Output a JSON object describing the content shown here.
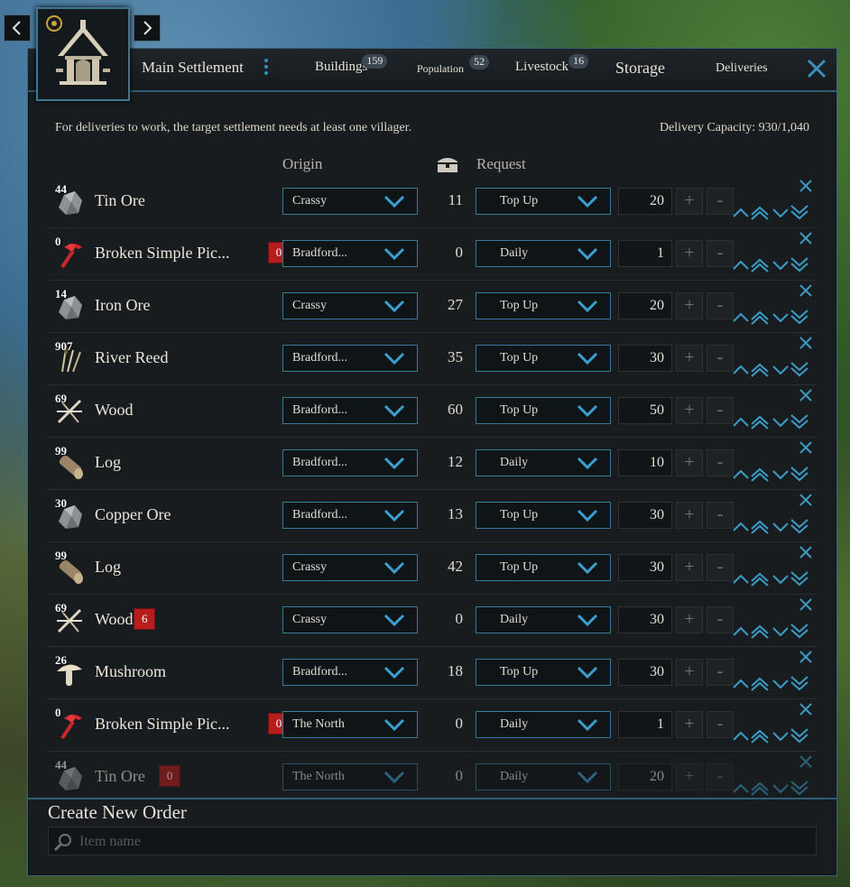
{
  "header": {
    "settlement_name": "Main Settlement",
    "tabs": [
      {
        "label": "Buildings",
        "count": "159"
      },
      {
        "label": "Population",
        "count": "52"
      },
      {
        "label": "Livestock",
        "count": "16"
      },
      {
        "label": "Storage",
        "count": ""
      },
      {
        "label": "Deliveries",
        "count": ""
      }
    ]
  },
  "info": {
    "message": "For deliveries to work, the target settlement needs at least one villager.",
    "capacity_label": "Delivery Capacity:",
    "capacity_value": "930/1,040"
  },
  "columns": {
    "origin": "Origin",
    "request": "Request"
  },
  "orders": [
    {
      "qty": "44",
      "name": "Tin Ore",
      "badge": "",
      "origin": "Crassy",
      "stock": "11",
      "request": "Top Up",
      "amount": "20",
      "icon": "ore-icon"
    },
    {
      "qty": "0",
      "name": "Broken Simple Pic...",
      "badge": "0",
      "origin": "Bradford...",
      "stock": "0",
      "request": "Daily",
      "amount": "1",
      "icon": "broken-pick-icon"
    },
    {
      "qty": "14",
      "name": "Iron Ore",
      "badge": "",
      "origin": "Crassy",
      "stock": "27",
      "request": "Top Up",
      "amount": "20",
      "icon": "ore-icon"
    },
    {
      "qty": "907",
      "name": "River Reed",
      "badge": "",
      "origin": "Bradford...",
      "stock": "35",
      "request": "Top Up",
      "amount": "30",
      "icon": "reed-icon"
    },
    {
      "qty": "69",
      "name": "Wood",
      "badge": "",
      "origin": "Bradford...",
      "stock": "60",
      "request": "Top Up",
      "amount": "50",
      "icon": "wood-icon"
    },
    {
      "qty": "99",
      "name": "Log",
      "badge": "",
      "origin": "Bradford...",
      "stock": "12",
      "request": "Daily",
      "amount": "10",
      "icon": "log-icon"
    },
    {
      "qty": "30",
      "name": "Copper Ore",
      "badge": "",
      "origin": "Bradford...",
      "stock": "13",
      "request": "Top Up",
      "amount": "30",
      "icon": "ore-icon"
    },
    {
      "qty": "99",
      "name": "Log",
      "badge": "",
      "origin": "Crassy",
      "stock": "42",
      "request": "Top Up",
      "amount": "30",
      "icon": "log-icon"
    },
    {
      "qty": "69",
      "name": "Wood",
      "badge": "6",
      "origin": "Crassy",
      "stock": "0",
      "request": "Daily",
      "amount": "30",
      "icon": "wood-icon"
    },
    {
      "qty": "26",
      "name": "Mushroom",
      "badge": "",
      "origin": "Bradford...",
      "stock": "18",
      "request": "Top Up",
      "amount": "30",
      "icon": "mushroom-icon"
    },
    {
      "qty": "0",
      "name": "Broken Simple Pic...",
      "badge": "0",
      "origin": "The North",
      "stock": "0",
      "request": "Daily",
      "amount": "1",
      "icon": "broken-pick-icon"
    },
    {
      "qty": "44",
      "name": "Tin Ore",
      "badge": "0",
      "origin": "The North",
      "stock": "0",
      "request": "Daily",
      "amount": "20",
      "icon": "ore-icon"
    }
  ],
  "create": {
    "title": "Create New Order",
    "placeholder": "Item name"
  },
  "buttons": {
    "plus": "+",
    "minus": "-"
  },
  "colors": {
    "accent": "#3b8fb8",
    "badge": "#b81d1d",
    "panel": "#191c1f"
  }
}
